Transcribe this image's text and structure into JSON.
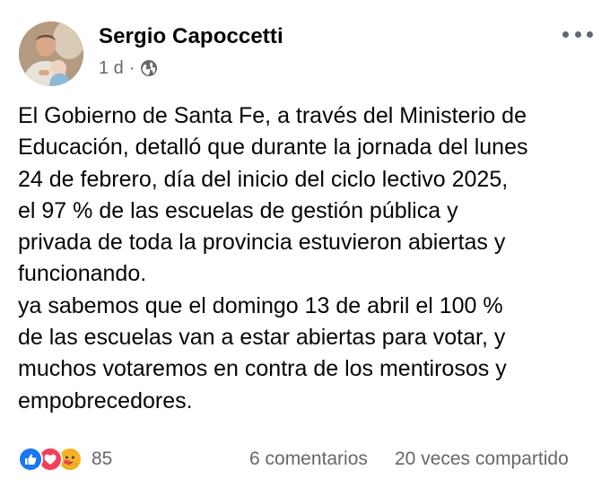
{
  "post": {
    "author": "Sergio Capoccetti",
    "timestamp": "1 d",
    "separator": "·",
    "privacy_icon": "globe-icon",
    "menu_icon": "more-horizontal-icon",
    "body_lines": [
      "El Gobierno de Santa Fe, a través del Ministerio de",
      "Educación, detalló que durante la jornada del lunes",
      "24 de febrero, día del inicio del ciclo lectivo 2025,",
      "el 97 % de las escuelas de gestión pública y",
      "privada de toda la provincia estuvieron abiertas y",
      "funcionando.",
      "ya sabemos que el domingo 13 de abril el 100 %",
      "de las escuelas van a estar abiertas para votar, y",
      "muchos votaremos en contra de los mentirosos y",
      "empobrecedores."
    ]
  },
  "footer": {
    "reaction_icons": [
      "like-icon",
      "love-icon",
      "care-icon"
    ],
    "reaction_count": "85",
    "comments": "6 comentarios",
    "shares": "20 veces compartido"
  },
  "colors": {
    "like": "#1877f2",
    "love": "#f33e58",
    "care": "#f7b125",
    "secondary_text": "#65676b"
  }
}
